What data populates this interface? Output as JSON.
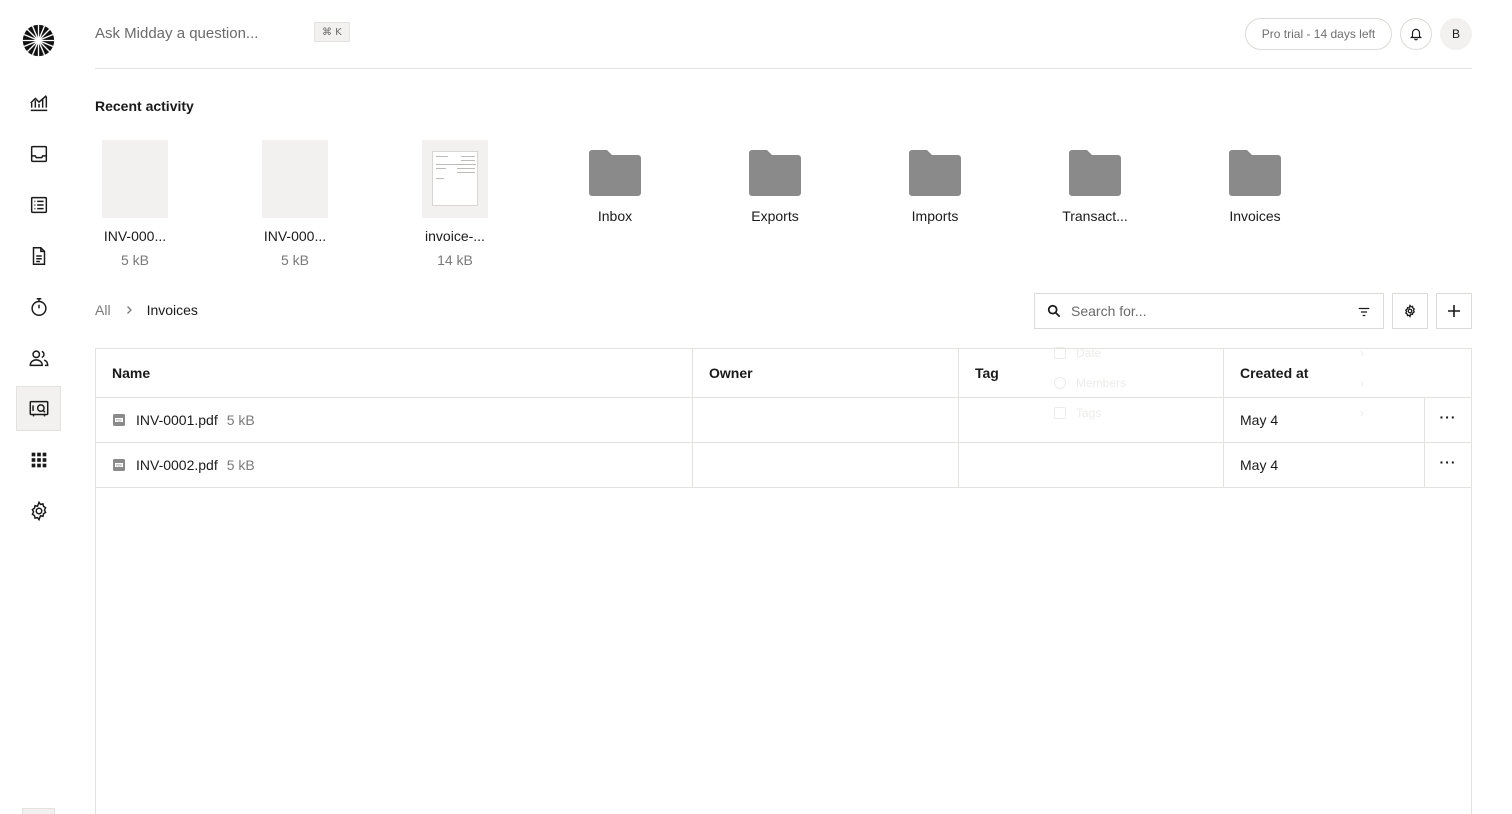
{
  "header": {
    "ask_placeholder": "Ask Midday a question...",
    "shortcut": "⌘ K",
    "trial_label": "Pro trial - 14 days left",
    "avatar_initial": "B"
  },
  "sidebar": {
    "items": [
      {
        "name": "overview",
        "icon": "chart-line-icon"
      },
      {
        "name": "inbox",
        "icon": "inbox-icon"
      },
      {
        "name": "transactions",
        "icon": "list-icon"
      },
      {
        "name": "invoices",
        "icon": "document-icon"
      },
      {
        "name": "tracker",
        "icon": "timer-icon"
      },
      {
        "name": "customers",
        "icon": "people-icon"
      },
      {
        "name": "vault",
        "icon": "vault-icon",
        "active": true
      },
      {
        "name": "apps",
        "icon": "grid-icon"
      },
      {
        "name": "settings",
        "icon": "gear-icon"
      }
    ]
  },
  "recent": {
    "title": "Recent activity",
    "files": [
      {
        "name": "INV-000...",
        "size": "5 kB"
      },
      {
        "name": "INV-000...",
        "size": "5 kB"
      },
      {
        "name": "invoice-...",
        "size": "14 kB"
      }
    ],
    "folders": [
      {
        "name": "Inbox"
      },
      {
        "name": "Exports"
      },
      {
        "name": "Imports"
      },
      {
        "name": "Transact..."
      },
      {
        "name": "Invoices"
      }
    ]
  },
  "breadcrumb": {
    "root": "All",
    "current": "Invoices"
  },
  "search": {
    "placeholder": "Search for..."
  },
  "table": {
    "headers": {
      "name": "Name",
      "owner": "Owner",
      "tag": "Tag",
      "created": "Created at"
    },
    "rows": [
      {
        "name": "INV-0001.pdf",
        "size": "5 kB",
        "owner": "",
        "tag": "",
        "created": "May 4",
        "actions": "···"
      },
      {
        "name": "INV-0002.pdf",
        "size": "5 kB",
        "owner": "",
        "tag": "",
        "created": "May 4",
        "actions": "···"
      }
    ]
  },
  "filter_menu": {
    "items": [
      "Date",
      "Members",
      "Tags"
    ]
  },
  "colors": {
    "folder": "#8a8a8a",
    "border": "#e4e2de",
    "thumb_bg": "#f2f1ef",
    "muted_text": "#7a7a7a"
  }
}
